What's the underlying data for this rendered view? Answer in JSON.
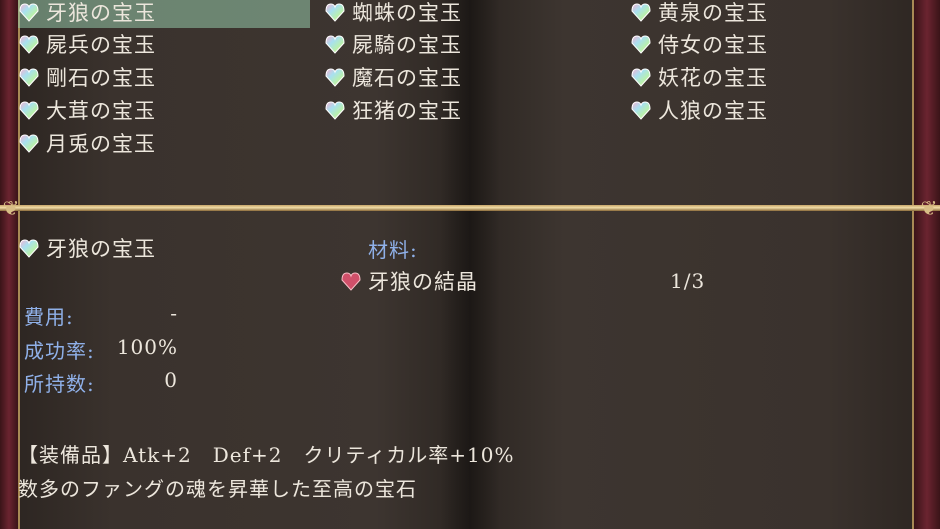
{
  "items": [
    {
      "label": "牙狼の宝玉",
      "selected": true
    },
    {
      "label": "屍兵の宝玉"
    },
    {
      "label": "剛石の宝玉"
    },
    {
      "label": "大茸の宝玉"
    },
    {
      "label": "月兎の宝玉"
    },
    {
      "label": "蜘蛛の宝玉"
    },
    {
      "label": "屍騎の宝玉"
    },
    {
      "label": "魔石の宝玉"
    },
    {
      "label": "狂猪の宝玉"
    },
    {
      "label": "黄泉の宝玉"
    },
    {
      "label": "侍女の宝玉"
    },
    {
      "label": "妖花の宝玉"
    },
    {
      "label": "人狼の宝玉"
    }
  ],
  "detail": {
    "name": "牙狼の宝玉",
    "cost_label": "費用:",
    "cost_value": "-",
    "success_label": "成功率:",
    "success_value": "100%",
    "owned_label": "所持数:",
    "owned_value": "0",
    "materials_label": "材料:",
    "material_name": "牙狼の結晶",
    "material_count": "1/3",
    "description_line1": "【装備品】Atk+2　Def+2　クリティカル率+10%",
    "description_line2": "数多のファングの魂を昇華した至高の宝石"
  },
  "colors": {
    "label_blue": "#8fb0e8",
    "selection": "#7fb89a",
    "gold": "#d8bd86"
  },
  "icons": {
    "item": "rainbow-gem-icon",
    "material": "red-crystal-icon"
  }
}
